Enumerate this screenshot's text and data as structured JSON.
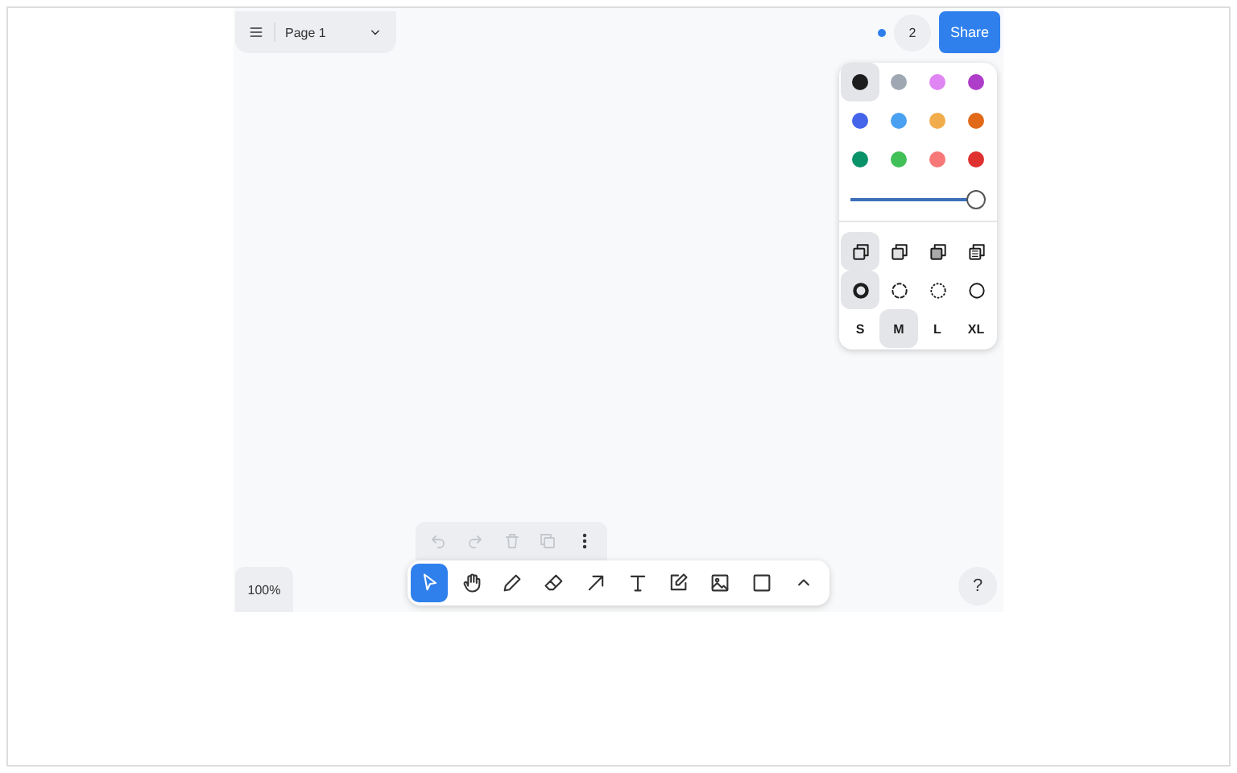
{
  "menu": {
    "page_name": "Page 1"
  },
  "people": {
    "count": "2"
  },
  "share_button": "Share",
  "style_panel": {
    "colors": [
      {
        "color": "#1d1d1d",
        "selected": true
      },
      {
        "color": "#9fa8b2",
        "selected": false
      },
      {
        "color": "#e085f4",
        "selected": false
      },
      {
        "color": "#ae3ec9",
        "selected": false
      },
      {
        "color": "#4465e9",
        "selected": false
      },
      {
        "color": "#4ba1f1",
        "selected": false
      },
      {
        "color": "#f1ac4b",
        "selected": false
      },
      {
        "color": "#e16919",
        "selected": false
      },
      {
        "color": "#099268",
        "selected": false
      },
      {
        "color": "#40c057",
        "selected": false
      },
      {
        "color": "#f87777",
        "selected": false
      },
      {
        "color": "#e03131",
        "selected": false
      }
    ],
    "opacity": {
      "level": 1
    },
    "fills": [
      {
        "kind": "none",
        "selected": true
      },
      {
        "kind": "semi",
        "selected": false
      },
      {
        "kind": "solid",
        "selected": false
      },
      {
        "kind": "pattern",
        "selected": false
      }
    ],
    "dashes": [
      {
        "kind": "draw",
        "selected": true
      },
      {
        "kind": "dashed",
        "selected": false
      },
      {
        "kind": "dotted",
        "selected": false
      },
      {
        "kind": "solid",
        "selected": false
      }
    ],
    "sizes": [
      {
        "label": "S",
        "selected": false
      },
      {
        "label": "M",
        "selected": true
      },
      {
        "label": "L",
        "selected": false
      },
      {
        "label": "XL",
        "selected": false
      }
    ]
  },
  "actions": [
    {
      "kind": "undo",
      "disabled": true
    },
    {
      "kind": "redo",
      "disabled": true
    },
    {
      "kind": "delete",
      "disabled": true
    },
    {
      "kind": "duplicate",
      "disabled": true
    },
    {
      "kind": "more",
      "disabled": false
    }
  ],
  "tools": [
    {
      "kind": "select",
      "selected": true
    },
    {
      "kind": "hand",
      "selected": false
    },
    {
      "kind": "draw",
      "selected": false
    },
    {
      "kind": "eraser",
      "selected": false
    },
    {
      "kind": "arrow",
      "selected": false
    },
    {
      "kind": "text",
      "selected": false
    },
    {
      "kind": "note",
      "selected": false
    },
    {
      "kind": "image",
      "selected": false
    },
    {
      "kind": "rectangle",
      "selected": false
    },
    {
      "kind": "more",
      "selected": false
    }
  ],
  "zoom": "100%",
  "help": "?"
}
